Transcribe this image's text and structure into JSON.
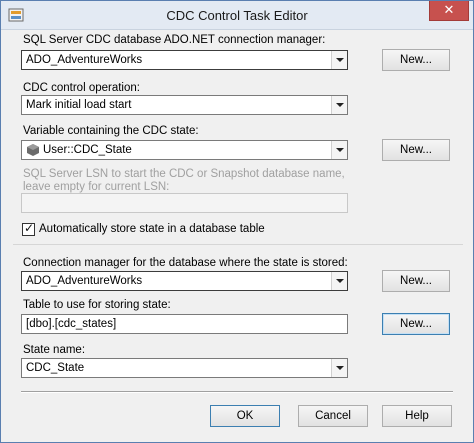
{
  "window": {
    "title": "CDC Control Task Editor",
    "close_glyph": "✕"
  },
  "connection": {
    "label": "SQL Server CDC database ADO.NET connection manager:",
    "value": "ADO_AdventureWorks",
    "new_label": "New..."
  },
  "operation": {
    "label": "CDC control operation:",
    "value": "Mark initial load start"
  },
  "variable": {
    "label": "Variable containing the CDC state:",
    "value": "User::CDC_State",
    "new_label": "New..."
  },
  "lsn": {
    "label": "SQL Server LSN to start the CDC or Snapshot database name, leave empty for current LSN:",
    "value": ""
  },
  "auto_store": {
    "label": "Automatically store state in a database table",
    "checked": true,
    "check_glyph": "✓"
  },
  "state_connection": {
    "label": "Connection manager for the database where the state is stored:",
    "value": "ADO_AdventureWorks",
    "new_label": "New..."
  },
  "state_table": {
    "label": "Table to use for storing state:",
    "value": "[dbo].[cdc_states]",
    "new_label": "New..."
  },
  "state_name": {
    "label": "State name:",
    "value": "CDC_State"
  },
  "footer": {
    "ok_label": "OK",
    "cancel_label": "Cancel",
    "help_label": "Help"
  },
  "icons": {
    "app": "cdc-task-icon",
    "variable": "variable-icon"
  }
}
